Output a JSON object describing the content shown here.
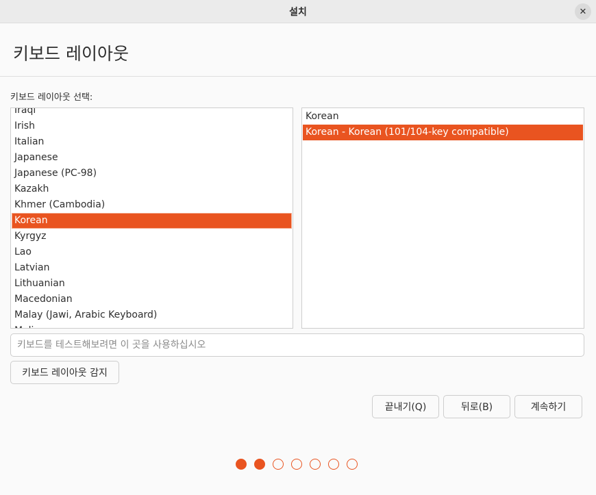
{
  "window": {
    "title": "설치",
    "close_glyph": "✕"
  },
  "header": {
    "title": "키보드 레이아웃"
  },
  "layout_select": {
    "label": "키보드 레이아웃 선택:",
    "layouts": [
      "Iraqi",
      "Irish",
      "Italian",
      "Japanese",
      "Japanese (PC-98)",
      "Kazakh",
      "Khmer (Cambodia)",
      "Korean",
      "Kyrgyz",
      "Lao",
      "Latvian",
      "Lithuanian",
      "Macedonian",
      "Malay (Jawi, Arabic Keyboard)",
      "Malian"
    ],
    "selected_layout": "Korean",
    "variants": [
      "Korean",
      "Korean - Korean (101/104-key compatible)"
    ],
    "selected_variant": "Korean - Korean (101/104-key compatible)"
  },
  "test_input": {
    "placeholder": "키보드를 테스트해보려면 이 곳을 사용하십시오",
    "value": ""
  },
  "buttons": {
    "detect": "키보드 레이아웃 감지",
    "quit": "끝내기(Q)",
    "back": "뒤로(B)",
    "continue": "계속하기"
  },
  "progress": {
    "total_steps": 7,
    "completed_steps": 2
  },
  "colors": {
    "accent": "#e95420",
    "background": "#fafafa",
    "titlebar": "#ebebeb"
  }
}
